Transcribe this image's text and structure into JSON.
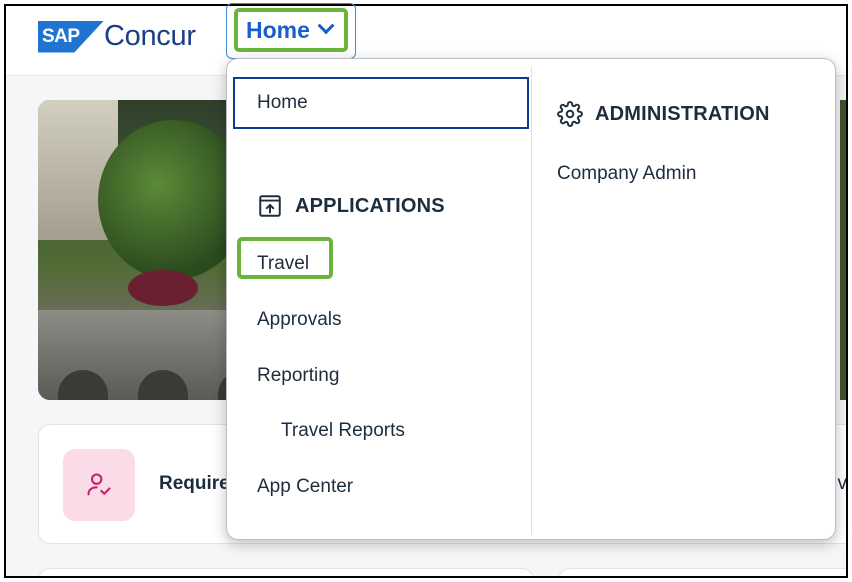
{
  "header": {
    "logo_sap": "SAP",
    "logo_concur": "Concur",
    "home_button": "Home"
  },
  "dropdown": {
    "home_item": "Home",
    "applications_heading": "APPLICATIONS",
    "applications": [
      "Travel",
      "Approvals",
      "Reporting",
      "Travel Reports",
      "App Center"
    ],
    "administration_heading": "ADMINISTRATION",
    "administration": [
      "Company Admin"
    ]
  },
  "card": {
    "label": "Required",
    "right_label": "v"
  },
  "colors": {
    "highlight_green": "#6ab43e",
    "brand_blue": "#1a5fc7",
    "focus_blue": "#0a3d91",
    "badge_pink": "#fbdbe8"
  },
  "icons": {
    "applications": "app-launch-icon",
    "administration": "gear-icon",
    "required": "user-check-icon",
    "home_chevron": "chevron-down-icon"
  }
}
